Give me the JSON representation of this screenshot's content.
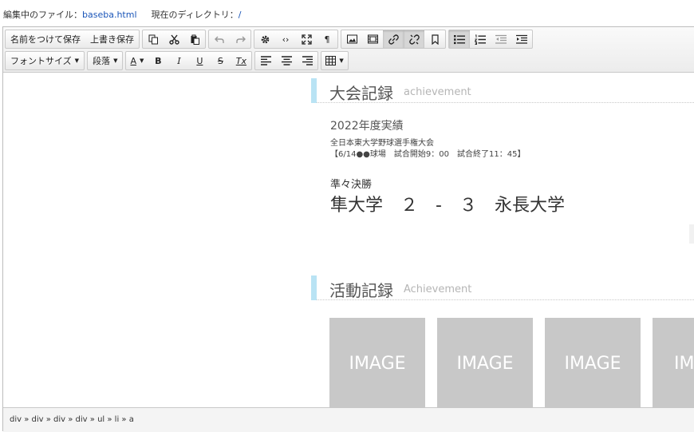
{
  "info": {
    "file_label": "編集中のファイル：",
    "file_name": "baseba.html",
    "dir_label": "現在のディレクトリ：",
    "dir_value": "/"
  },
  "toolbar": {
    "save_as": "名前をつけて保存",
    "overwrite": "上書き保存",
    "font_size": "フォントサイズ",
    "paragraph": "段落",
    "font_color": "A",
    "bold": "B",
    "italic": "I",
    "underline": "U",
    "strike": "S",
    "clear_format": "Tx",
    "source_glyph": "‹›",
    "pilcrow": "¶"
  },
  "content": {
    "section1": {
      "title": "大会記録",
      "subtitle": "achievement"
    },
    "year": "2022年度実績",
    "tournament_name": "全日本東大学野球選手権大会",
    "tournament_detail": "【6/14●●球場　試合開始9：00　試合終了11：45】",
    "round": "準々決勝",
    "score": "隼大学　２　-　３　永長大学",
    "section2": {
      "title": "活動記録",
      "subtitle": "Achievement"
    },
    "tiles": [
      "IMAGE",
      "IMAGE",
      "IMAGE",
      "IMA"
    ]
  },
  "status": {
    "path": "div » div » div » div » ul » li » a"
  },
  "colors": {
    "accent_bar": "#b9e3f4",
    "tile": "#c8c8c8",
    "link": "#1a55b8"
  }
}
